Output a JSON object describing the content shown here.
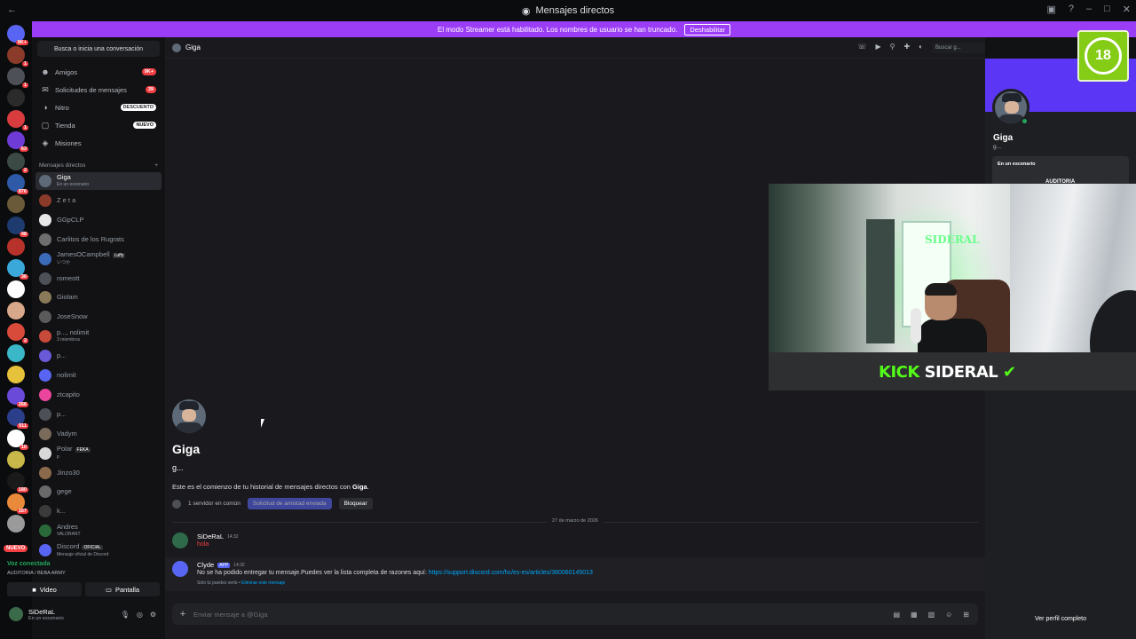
{
  "window": {
    "title": "Mensajes directos",
    "back_icon": "arrow-left-icon"
  },
  "streamer_banner": {
    "text": "El modo Streamer está habilitado. Los nombres de usuario se han truncado.",
    "button": "Deshabilitar"
  },
  "servers": [
    {
      "badge": "9K+",
      "color": "#5865f2"
    },
    {
      "badge": "1",
      "color": "#8a3b2a"
    },
    {
      "badge": "1",
      "color": "#4e5058"
    },
    {
      "badge": "",
      "color": "#2b2b2b"
    },
    {
      "badge": "1",
      "color": "#d83c3e"
    },
    {
      "badge": "63",
      "color": "#6e3bd6"
    },
    {
      "badge": "2",
      "color": "#3b4a45"
    },
    {
      "badge": "876",
      "color": "#2e5aa8"
    },
    {
      "badge": "",
      "color": "#6b5a3a"
    },
    {
      "badge": "48",
      "color": "#1d3b6e"
    },
    {
      "badge": "",
      "color": "#b7322a"
    },
    {
      "badge": "36",
      "color": "#3aa8d8"
    },
    {
      "badge": "",
      "color": "#ffffff"
    },
    {
      "badge": "",
      "color": "#d8a88a"
    },
    {
      "badge": "2",
      "color": "#d84a3a"
    },
    {
      "badge": "",
      "color": "#3ab8c8"
    },
    {
      "badge": "",
      "color": "#e6c23a"
    },
    {
      "badge": "266",
      "color": "#6a4ad8"
    },
    {
      "badge": "911",
      "color": "#2a3e8a"
    },
    {
      "badge": "10",
      "color": "#ffffff"
    },
    {
      "badge": "",
      "color": "#c8b84a"
    },
    {
      "badge": "180",
      "color": "#1a1a1a"
    },
    {
      "badge": "167",
      "color": "#e88a3a"
    },
    {
      "badge": "",
      "color": "#9a9a9a"
    }
  ],
  "servers_new_label": "NUEVO",
  "sidebar": {
    "search": "Busca o inicia una conversación",
    "nav": [
      {
        "label": "Amigos",
        "pill": "9K+",
        "icon": "friends-icon"
      },
      {
        "label": "Solicitudes de mensajes",
        "pill": "39",
        "icon": "message-request-icon"
      },
      {
        "label": "Nitro",
        "pill": "DESCUENTO",
        "icon": "nitro-icon"
      },
      {
        "label": "Tienda",
        "pill": "NUEVO",
        "icon": "shop-icon"
      },
      {
        "label": "Misiones",
        "pill": "",
        "icon": "quest-icon"
      }
    ],
    "dm_header": "Mensajes directos",
    "dm_add": "+",
    "dms": [
      {
        "name": "Giga",
        "sub": "En un escenario",
        "color": "#5e6a78",
        "tag": ""
      },
      {
        "name": "Z e t a",
        "sub": "",
        "color": "#8a3b2a",
        "tag": ""
      },
      {
        "name": "GGpCLP",
        "sub": "",
        "color": "#e8e8e8",
        "tag": ""
      },
      {
        "name": "Carlitos de los Rugrats",
        "sub": "",
        "color": "#6e6e6e",
        "tag": ""
      },
      {
        "name": "JamesOCampbell",
        "sub": "いつか",
        "color": "#3a6ab8",
        "tag": "Luffy"
      },
      {
        "name": "romeott",
        "sub": "",
        "color": "#4e5058",
        "tag": ""
      },
      {
        "name": "Giolam",
        "sub": "",
        "color": "#8a7a5a",
        "tag": ""
      },
      {
        "name": "JoseSnow",
        "sub": "",
        "color": "#5a5a5a",
        "tag": ""
      },
      {
        "name": "p..., nolimit",
        "sub": "3 miembros",
        "color": "#c84a3a",
        "tag": ""
      },
      {
        "name": "p...",
        "sub": "",
        "color": "#6a5ad8",
        "tag": ""
      },
      {
        "name": "nolimit",
        "sub": "",
        "color": "#5865f2",
        "tag": ""
      },
      {
        "name": "ztcapito",
        "sub": "",
        "color": "#eb459e",
        "tag": ""
      },
      {
        "name": "p...",
        "sub": "",
        "color": "#4e5058",
        "tag": ""
      },
      {
        "name": "Vadym",
        "sub": "",
        "color": "#7a6a5a",
        "tag": ""
      },
      {
        "name": "Polar",
        "sub": "p",
        "color": "#d8d8d8",
        "tag": "FEKA"
      },
      {
        "name": "Jinzo30",
        "sub": "",
        "color": "#8a6a4a",
        "tag": ""
      },
      {
        "name": "gege",
        "sub": "",
        "color": "#6a6a6a",
        "tag": ""
      },
      {
        "name": "k...",
        "sub": "",
        "color": "#3a3a3a",
        "tag": ""
      },
      {
        "name": "Andres",
        "sub": "VALORANT",
        "color": "#2a6a3a",
        "tag": ""
      },
      {
        "name": "Discord",
        "sub": "Mensaje oficial de Discord",
        "color": "#5865f2",
        "tag": "OFICIAL"
      }
    ]
  },
  "voice": {
    "title": "Voz conectada",
    "channel": "AUDITORIA / BEBA ARMY",
    "video_btn": "Video",
    "screen_btn": "Pantalla"
  },
  "user": {
    "name": "SiDeRaL",
    "status": "En un escenario"
  },
  "chat": {
    "recipient": "Giga",
    "search_placeholder": "Buscar g...",
    "intro_name": "Giga",
    "intro_handle": "g...",
    "intro_text_pre": "Este es el comienzo de tu historial de mensajes directos con ",
    "intro_text_name": "Giga",
    "intro_text_post": ".",
    "mutual": "1 servidor en común",
    "pending_btn": "Solicitud de amistad enviada",
    "block_btn": "Bloquear",
    "date_divider": "27 de marzo de 2026",
    "messages": [
      {
        "author": "SiDeRaL",
        "time": "14:32",
        "body": "hola"
      },
      {
        "author": "Clyde",
        "tag": "APP",
        "time": "14:32",
        "body": "No se ha podido entregar tu mensaje.Puedes ver la lista completa de razones aquí: ",
        "link": "https://support.discord.com/hc/es-es/articles/360060145013",
        "note_a": "Solo tú puedes verlo • ",
        "note_b": "Eliminar este mensaje"
      }
    ],
    "composer_placeholder": "Enviar mensaje a @Giga"
  },
  "profile": {
    "name": "Giga",
    "handle": "g...",
    "stage_title": "En un escenario",
    "stage_name": "AUDITORIA",
    "full_profile": "Ver perfil completo"
  },
  "overlay": {
    "rating": "18",
    "cam_brand_a": "KICK",
    "cam_brand_b": "SIDERAL",
    "neon": "SIDERAL"
  },
  "colors": {
    "banner": "#9b3cf6",
    "profile_banner": "#5b37f5",
    "kick_green": "#53fc18",
    "online": "#23a55a"
  }
}
